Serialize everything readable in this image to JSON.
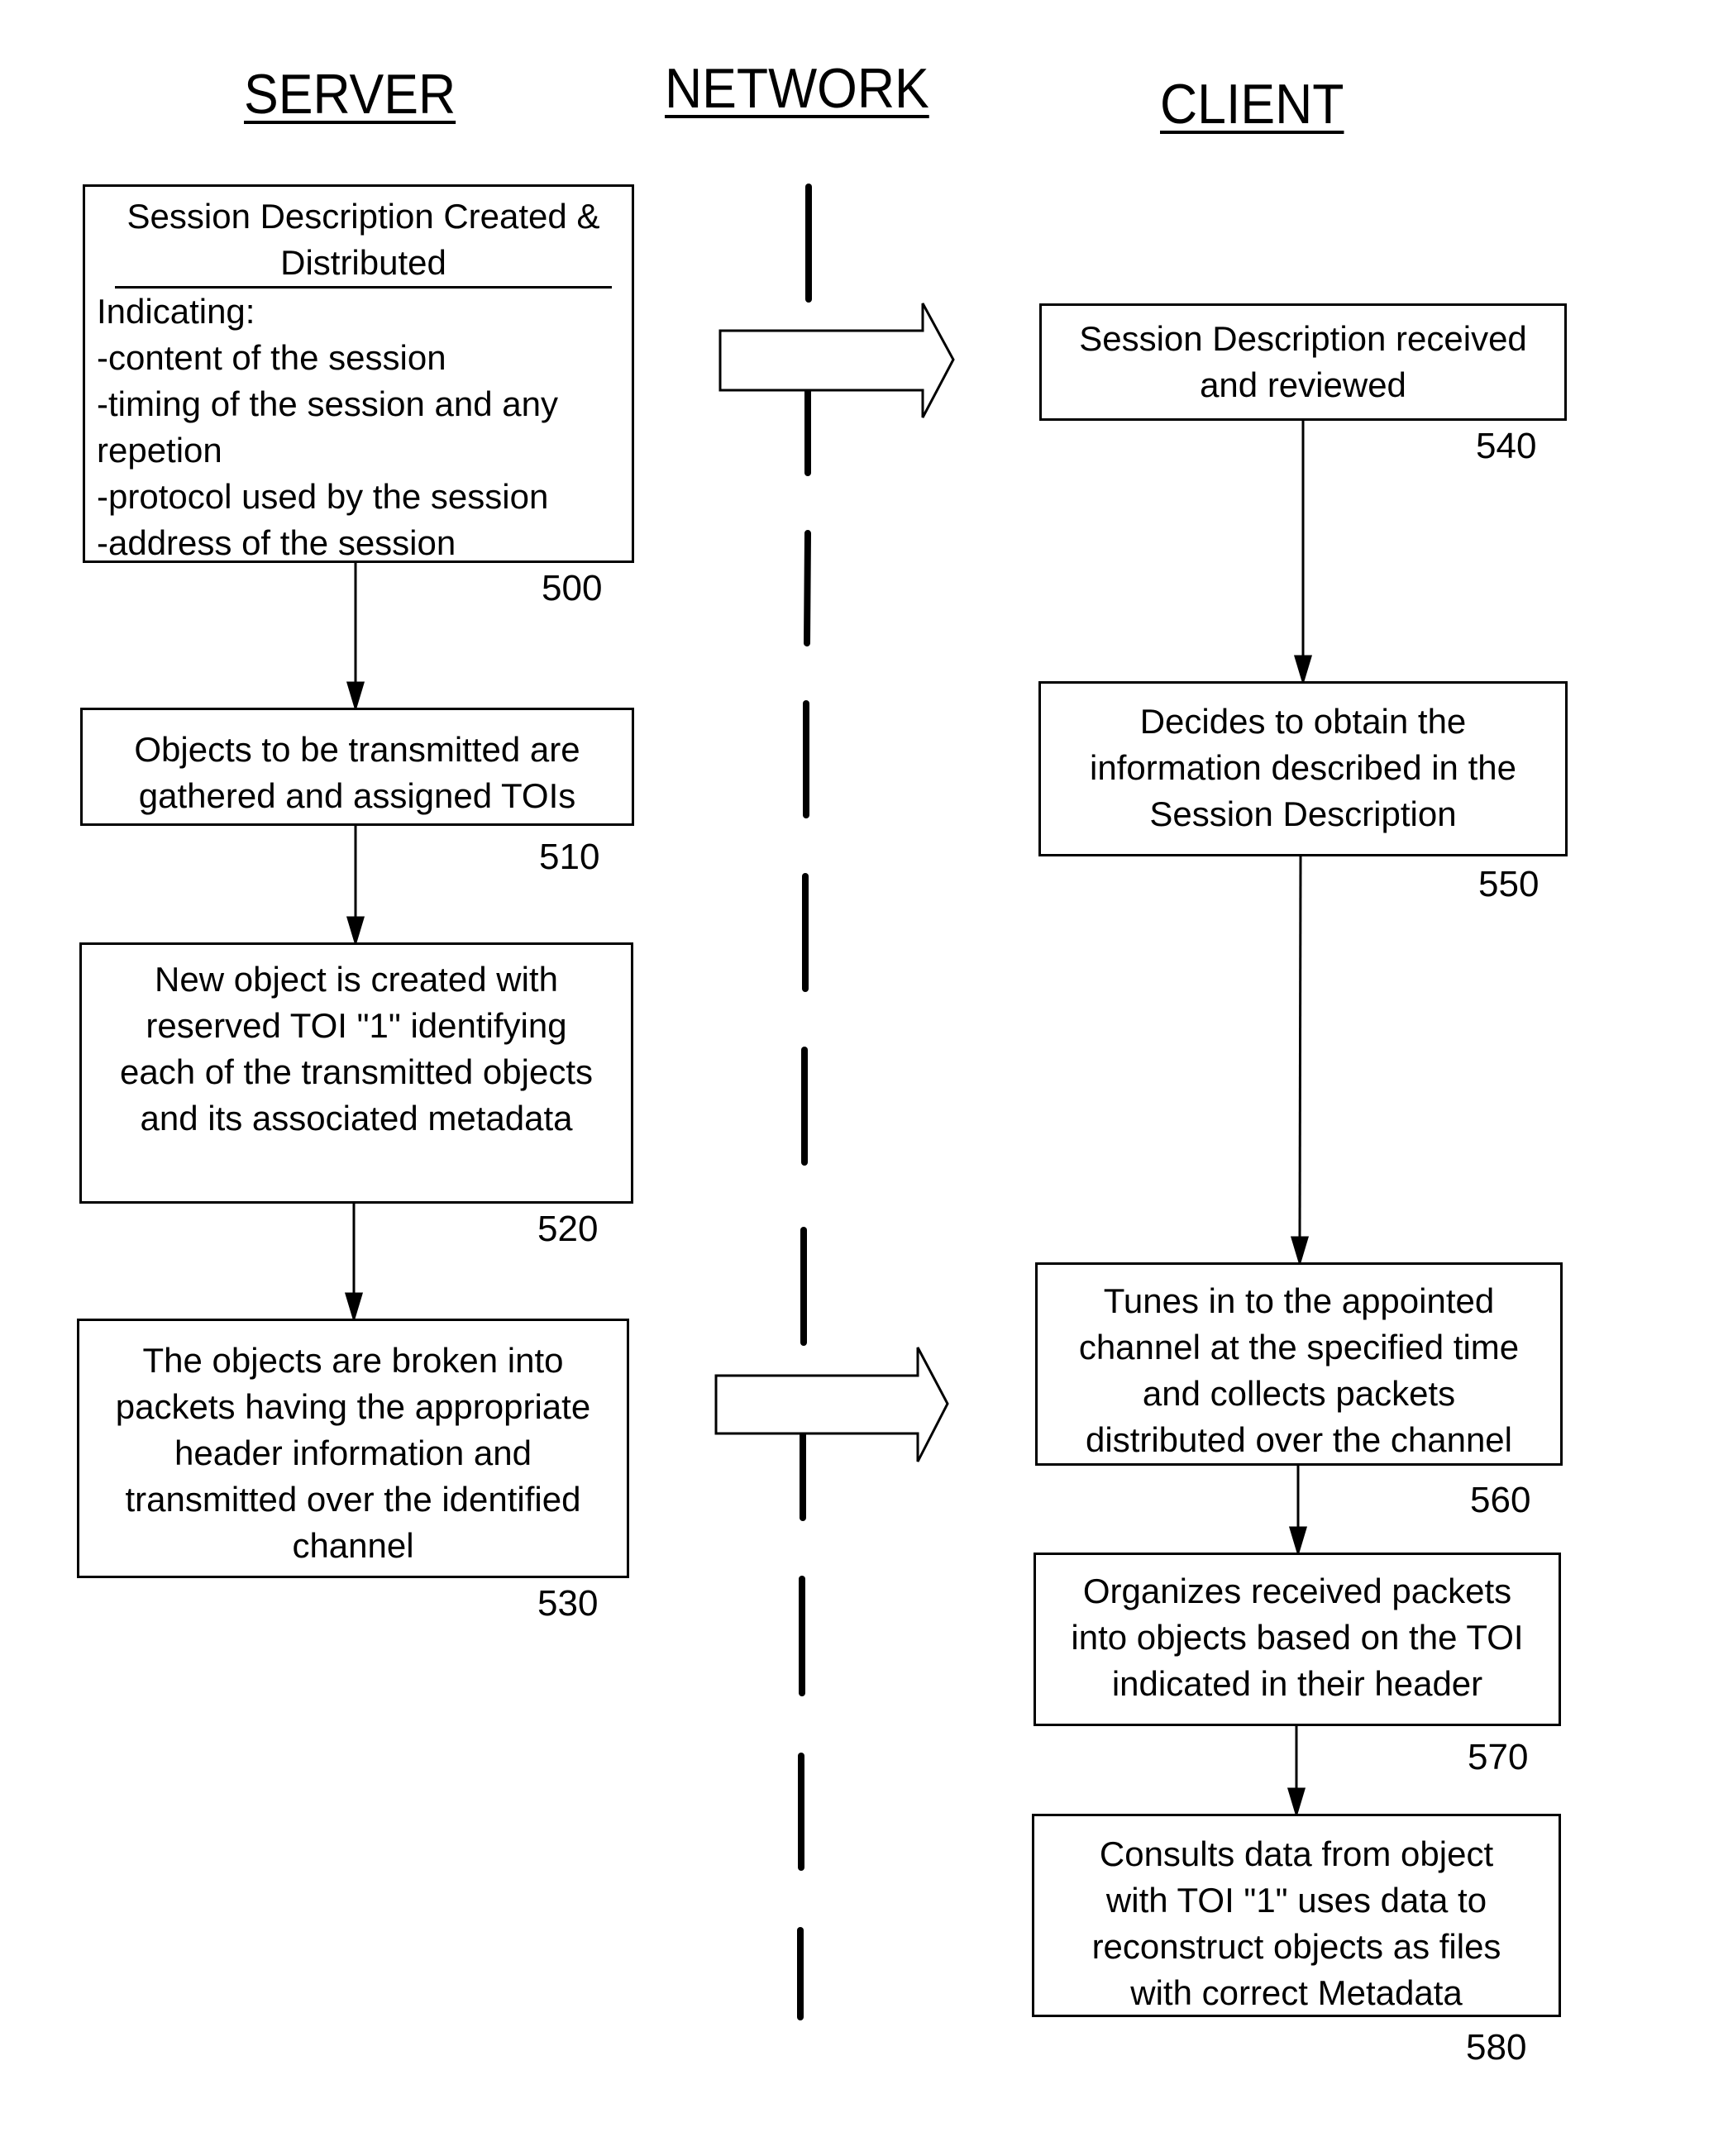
{
  "headers": {
    "server": "SERVER",
    "network": "NETWORK",
    "client": "CLIENT"
  },
  "server_steps": [
    {
      "ref": "500",
      "title_lines": [
        "Session Description Created &",
        "Distributed"
      ],
      "lines": [
        "Indicating:",
        "-content of the session",
        "-timing of the session and any",
        "repetion",
        "-protocol used by the session",
        "-address of the session"
      ]
    },
    {
      "ref": "510",
      "lines": [
        "Objects to be transmitted are",
        "gathered and assigned TOIs"
      ]
    },
    {
      "ref": "520",
      "lines": [
        "New object is created with",
        "reserved TOI \"1\" identifying",
        "each of the transmitted objects",
        "and its associated metadata"
      ]
    },
    {
      "ref": "530",
      "lines": [
        "The objects are broken into",
        "packets having the appropriate",
        "header information and",
        "transmitted over the identified",
        "channel"
      ]
    }
  ],
  "client_steps": [
    {
      "ref": "540",
      "lines": [
        "Session Description received",
        "and reviewed"
      ]
    },
    {
      "ref": "550",
      "lines": [
        "Decides to obtain the",
        "information described in the",
        "Session Description"
      ]
    },
    {
      "ref": "560",
      "lines": [
        "Tunes in to the appointed",
        "channel at the specified time",
        "and collects packets",
        "distributed over the channel"
      ]
    },
    {
      "ref": "570",
      "lines": [
        "Organizes received packets",
        "into objects based on the TOI",
        "indicated in their header"
      ]
    },
    {
      "ref": "580",
      "lines": [
        "Consults data from object",
        "with TOI \"1\" uses data to",
        "reconstruct objects as files",
        "with correct Metadata"
      ]
    }
  ],
  "network_transfers": [
    {
      "from": "500",
      "to": "540",
      "icon": "block-arrow-right"
    },
    {
      "from": "530",
      "to": "560",
      "icon": "block-arrow-right"
    }
  ]
}
